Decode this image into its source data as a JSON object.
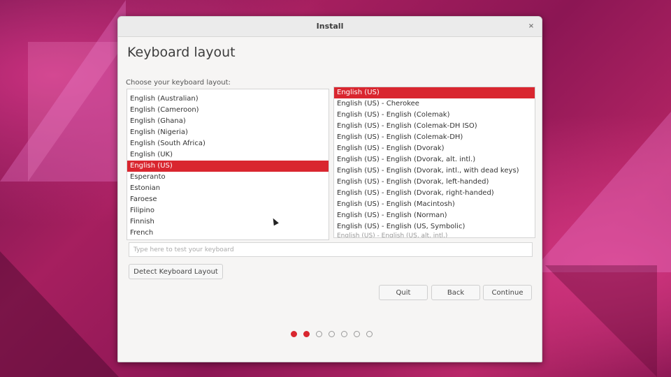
{
  "window": {
    "title": "Install",
    "close_label": "×"
  },
  "page": {
    "heading": "Keyboard layout",
    "choose_label": "Choose your keyboard layout:"
  },
  "layouts": {
    "items": [
      "English (Australian)",
      "English (Cameroon)",
      "English (Ghana)",
      "English (Nigeria)",
      "English (South Africa)",
      "English (UK)",
      "English (US)",
      "Esperanto",
      "Estonian",
      "Faroese",
      "Filipino",
      "Finnish",
      "French"
    ],
    "selected": "English (US)"
  },
  "variants": {
    "items": [
      "English (US)",
      "English (US) - Cherokee",
      "English (US) - English (Colemak)",
      "English (US) - English (Colemak-DH ISO)",
      "English (US) - English (Colemak-DH)",
      "English (US) - English (Dvorak)",
      "English (US) - English (Dvorak, alt. intl.)",
      "English (US) - English (Dvorak, intl., with dead keys)",
      "English (US) - English (Dvorak, left-handed)",
      "English (US) - English (Dvorak, right-handed)",
      "English (US) - English (Macintosh)",
      "English (US) - English (Norman)",
      "English (US) - English (US, Symbolic)"
    ],
    "partial_item": "English (US) - English (US, alt. intl.)",
    "selected": "English (US)"
  },
  "test_input": {
    "placeholder": "Type here to test your keyboard",
    "value": ""
  },
  "buttons": {
    "detect": "Detect Keyboard Layout",
    "quit": "Quit",
    "back": "Back",
    "continue": "Continue"
  },
  "progress": {
    "total_steps": 7,
    "current_step": 2
  },
  "colors": {
    "accent": "#d9262f"
  }
}
